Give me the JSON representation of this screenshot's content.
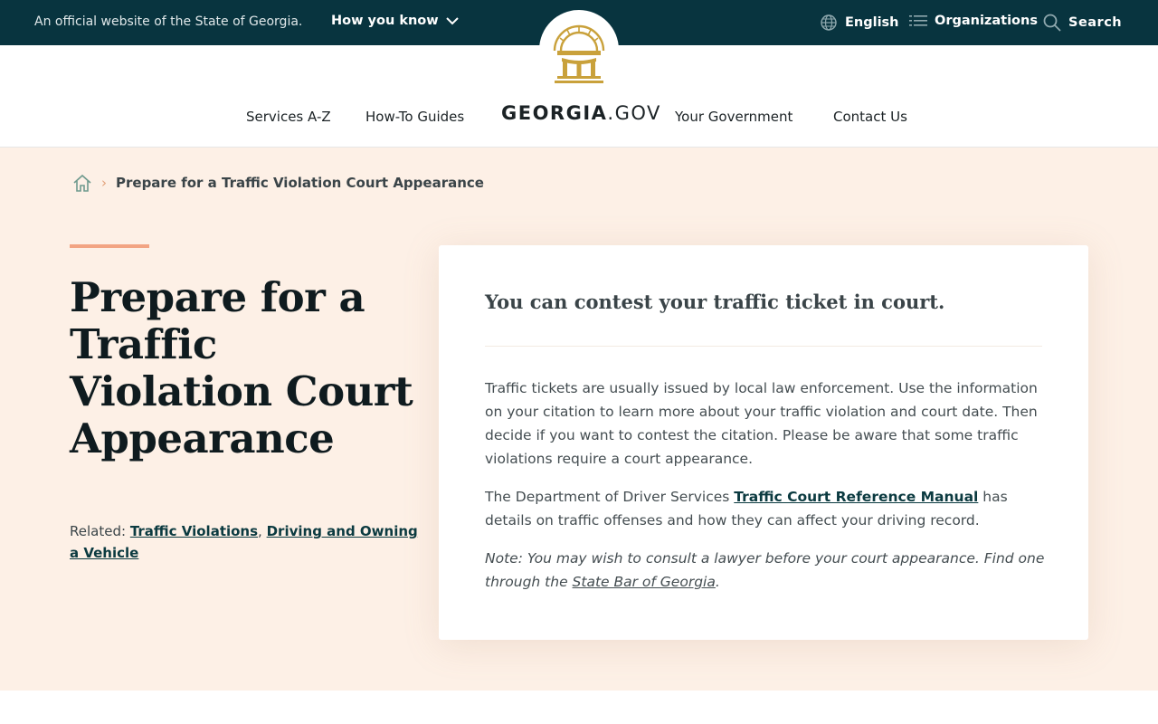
{
  "topbar": {
    "official_text": "An official website of the State of Georgia.",
    "how_you_know": "How you know",
    "language": "English",
    "organizations": "Organizations",
    "search": "Search",
    "icons": [
      "globe-icon",
      "list-icon",
      "search-icon",
      "chevron-down-icon"
    ]
  },
  "nav": {
    "links": [
      "Services A-Z",
      "How-To Guides",
      "Your Government",
      "Contact Us"
    ],
    "brand_bold": "GEORGIA",
    "brand_light": ".GOV"
  },
  "breadcrumb": {
    "current": "Prepare for a Traffic Violation Court Appearance"
  },
  "hero": {
    "title": "Prepare for a Traffic Violation Court Appearance",
    "related_label": "Related:",
    "related_links": [
      "Traffic Violations",
      "Driving and Owning a Vehicle"
    ],
    "related_sep": ","
  },
  "card": {
    "heading": "You can contest your traffic ticket in court.",
    "p1": "Traffic tickets are usually issued by local law enforcement. Use the information on your citation to learn more about your traffic violation and court date. Then decide if you want to contest the citation. Please be aware that some traffic violations require a court appearance.",
    "p2_before": "The Department of Driver Services ",
    "p2_link": "Traffic Court Reference Manual",
    "p2_after": " has details on traffic offenses and how they can affect your driving record.",
    "note_before": "Note: You may wish to consult a lawyer before your court appearance. Find one through the ",
    "note_link": "State Bar of Georgia",
    "note_after": "."
  },
  "colors": {
    "topbar_bg": "#08343f",
    "hero_bg": "#fdf0e6",
    "accent": "#f2a483",
    "seal_gold": "#c9a13b",
    "link": "#0b3a40"
  }
}
